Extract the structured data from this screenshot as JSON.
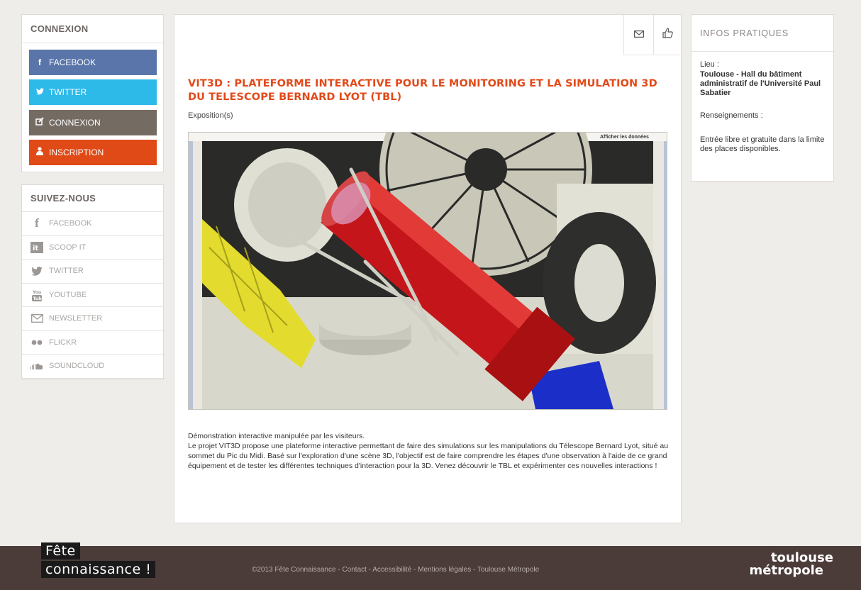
{
  "connexion": {
    "title": "CONNEXION",
    "buttons": [
      {
        "label": "FACEBOOK",
        "icon": "facebook-icon"
      },
      {
        "label": "TWITTER",
        "icon": "twitter-icon"
      },
      {
        "label": "CONNEXION",
        "icon": "edit-icon"
      },
      {
        "label": "INSCRIPTION",
        "icon": "user-icon"
      }
    ]
  },
  "follow": {
    "title": "SUIVEZ-NOUS",
    "items": [
      {
        "label": "FACEBOOK",
        "icon": "facebook-icon"
      },
      {
        "label": "SCOOP IT",
        "icon": "scoopit-icon"
      },
      {
        "label": "TWITTER",
        "icon": "twitter-icon"
      },
      {
        "label": "YOUTUBE",
        "icon": "youtube-icon"
      },
      {
        "label": "NEWSLETTER",
        "icon": "envelope-icon"
      },
      {
        "label": "FLICKR",
        "icon": "flickr-icon"
      },
      {
        "label": "SOUNDCLOUD",
        "icon": "soundcloud-icon"
      }
    ]
  },
  "article": {
    "title": "VIT3D : PLATEFORME INTERACTIVE POUR LE MONITORING ET LA SIMULATION 3D DU TELESCOPE BERNARD LYOT (TBL)",
    "category": "Exposition(s)",
    "image_toolbar": "Afficher les données",
    "description": [
      "Démonstration interactive manipulée par les visiteurs.",
      "Le projet VIT3D propose une plateforme interactive permettant de faire des simulations sur  les manipulations du Télescope Bernard Lyot, situé au sommet du Pic du Midi. Basé sur l'exploration d'une scène 3D, l'objectif est de faire comprendre les étapes d'une observation à l'aide de ce grand équipement et de tester les différentes techniques d'interaction pour la 3D. Venez découvrir le TBL et expérimenter ces nouvelles interactions !"
    ]
  },
  "infos": {
    "title": "INFOS PRATIQUES",
    "lieu_label": "Lieu :",
    "lieu_value": "Toulouse - Hall du bâtiment administratif de l'Université Paul Sabatier",
    "renseignements_label": "Renseignements :",
    "renseignements_value": "Entrée libre et gratuite dans la limite des places disponibles."
  },
  "footer": {
    "logo_line1": "Fête",
    "logo_line2": "connaissance !",
    "text": "©2013 Fête Connaissance -  Contact -  Accessibilité -  Mentions légales -  Toulouse Métropole",
    "partner_line1": "toulouse",
    "partner_line2": "métropole"
  },
  "colors": {
    "facebook": "#5a75a9",
    "twitter": "#2dbae9",
    "connexion": "#746b63",
    "inscription": "#e04a17",
    "title": "#e24a1a",
    "footer": "#4b3c39"
  }
}
